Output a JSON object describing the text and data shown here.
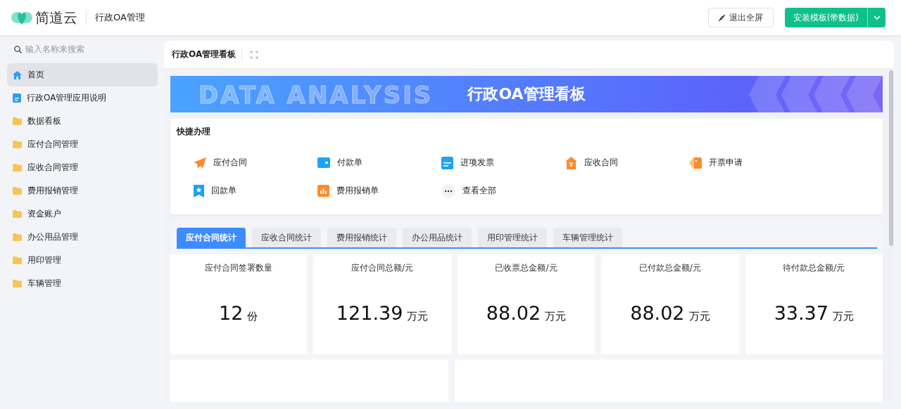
{
  "header": {
    "brand": "简道云",
    "app_title": "行政OA管理",
    "exit_button": "退出全屏",
    "install_button": "安装模板(带数据)"
  },
  "sidebar": {
    "search_placeholder": "输入名称来搜索",
    "items": [
      {
        "label": "首页",
        "kind": "home",
        "selected": true
      },
      {
        "label": "行政OA管理应用说明",
        "kind": "doc",
        "selected": false
      },
      {
        "label": "数据看板",
        "kind": "folder",
        "selected": false
      },
      {
        "label": "应付合同管理",
        "kind": "folder",
        "selected": false
      },
      {
        "label": "应收合同管理",
        "kind": "folder",
        "selected": false
      },
      {
        "label": "费用报销管理",
        "kind": "folder",
        "selected": false
      },
      {
        "label": "资金账户",
        "kind": "folder",
        "selected": false
      },
      {
        "label": "办公用品管理",
        "kind": "folder",
        "selected": false
      },
      {
        "label": "用印管理",
        "kind": "folder",
        "selected": false
      },
      {
        "label": "车辆管理",
        "kind": "folder",
        "selected": false
      }
    ]
  },
  "dashboard": {
    "title": "行政OA管理看板",
    "banner": {
      "title": "行政OA管理看板",
      "backdrop": "DATA ANALYSIS"
    },
    "quick": {
      "title": "快捷办理",
      "items": [
        {
          "label": "应付合同",
          "kind": "plane"
        },
        {
          "label": "付款单",
          "kind": "wallet"
        },
        {
          "label": "进项发票",
          "kind": "invoice"
        },
        {
          "label": "应收合同",
          "kind": "yen"
        },
        {
          "label": "开票申请",
          "kind": "tag"
        },
        {
          "label": "回款单",
          "kind": "bookmark"
        },
        {
          "label": "费用报销单",
          "kind": "chart"
        },
        {
          "label": "查看全部",
          "kind": "more"
        }
      ]
    },
    "tabs": [
      {
        "label": "应付合同统计",
        "selected": true
      },
      {
        "label": "应收合同统计",
        "selected": false
      },
      {
        "label": "费用报销统计",
        "selected": false
      },
      {
        "label": "办公用品统计",
        "selected": false
      },
      {
        "label": "用印管理统计",
        "selected": false
      },
      {
        "label": "车辆管理统计",
        "selected": false
      }
    ],
    "stats": [
      {
        "title": "应付合同签署数量",
        "value": "12",
        "unit": "份"
      },
      {
        "title": "应付合同总额/元",
        "value": "121.39",
        "unit": "万元"
      },
      {
        "title": "已收票总金额/元",
        "value": "88.02",
        "unit": "万元"
      },
      {
        "title": "已付款总金额/元",
        "value": "88.02",
        "unit": "万元"
      },
      {
        "title": "待付款总金额/元",
        "value": "33.37",
        "unit": "万元"
      }
    ]
  }
}
